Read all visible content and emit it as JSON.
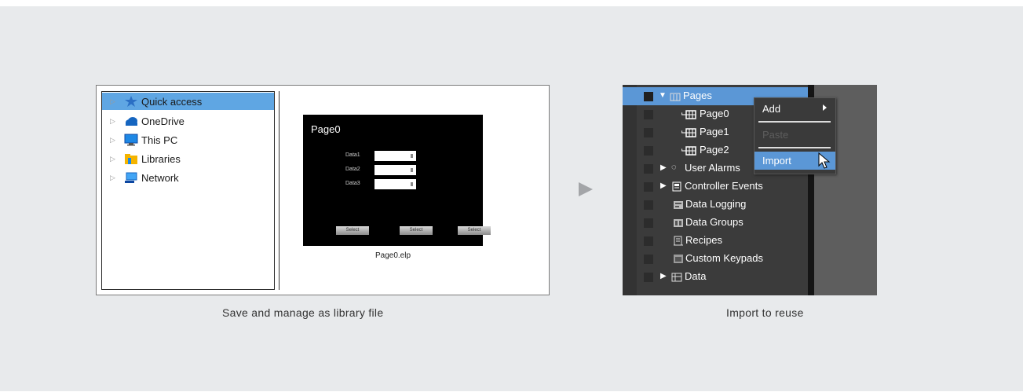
{
  "left_panel": {
    "tree_items": [
      {
        "label": "Quick access",
        "icon": "star-icon",
        "selected": true
      },
      {
        "label": "OneDrive",
        "icon": "cloud-icon",
        "selected": false
      },
      {
        "label": "This PC",
        "icon": "computer-icon",
        "selected": false
      },
      {
        "label": "Libraries",
        "icon": "library-icon",
        "selected": false
      },
      {
        "label": "Network",
        "icon": "network-icon",
        "selected": false
      }
    ],
    "preview": {
      "title": "Page0",
      "fields": [
        "Data1",
        "Data2",
        "Data3"
      ],
      "buttons": [
        "Select",
        "Select",
        "Select"
      ]
    },
    "file_name": "Page0.elp",
    "caption": "Save and manage as library file"
  },
  "right_panel": {
    "tree": {
      "pages": "Pages",
      "page0": "Page0",
      "page1": "Page1",
      "page2": "Page2",
      "user_alarms": "User Alarms",
      "controller_events": "Controller Events",
      "data_logging": "Data Logging",
      "data_groups": "Data Groups",
      "recipes": "Recipes",
      "custom_keypads": "Custom Keypads",
      "data": "Data"
    },
    "context_menu": {
      "add": "Add",
      "paste": "Paste",
      "import": "Import"
    },
    "caption": "Import to reuse"
  },
  "colors": {
    "background": "#e8eaec",
    "explorer_selection": "#5fa6e3",
    "ide_selection": "#5b97d6",
    "arrow": "#a3a5a8"
  }
}
